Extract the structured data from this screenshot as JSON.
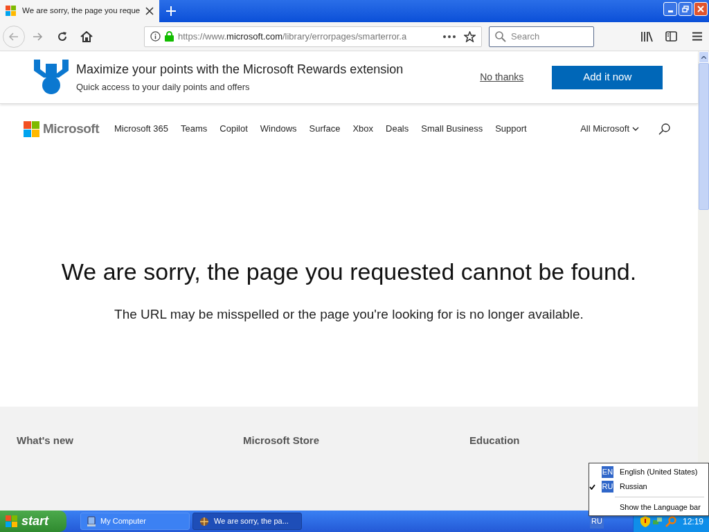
{
  "browser": {
    "tab": {
      "title": "We are sorry, the page you reque"
    },
    "url_prefix": "https://www.",
    "url_domain": "microsoft.com",
    "url_path": "/library/errorpages/smarterror.a",
    "search": {
      "placeholder": "Search"
    }
  },
  "banner": {
    "title": "Maximize your points with the Microsoft Rewards extension",
    "subtitle": "Quick access to your daily points and offers",
    "dismiss": "No thanks",
    "action": "Add it now"
  },
  "site_nav": {
    "logo": "Microsoft",
    "items": [
      "Microsoft 365",
      "Teams",
      "Copilot",
      "Windows",
      "Surface",
      "Xbox",
      "Deals",
      "Small Business",
      "Support"
    ],
    "all_menu": "All Microsoft"
  },
  "error": {
    "heading": "We are sorry, the page you requested cannot be found.",
    "message": "The URL may be misspelled or the page you're looking for is no longer available."
  },
  "footer": {
    "columns": [
      "What's new",
      "Microsoft Store",
      "Education"
    ]
  },
  "language_menu": {
    "items": [
      {
        "code": "EN",
        "label": "English (United States)",
        "checked": false
      },
      {
        "code": "RU",
        "label": "Russian",
        "checked": true
      }
    ],
    "show_bar": "Show the Language bar"
  },
  "taskbar": {
    "start": "start",
    "windows": [
      {
        "label": "My Computer",
        "selected": false
      },
      {
        "label": "We are sorry, the pa...",
        "selected": true
      }
    ],
    "language": "RU",
    "clock": "12:19"
  }
}
